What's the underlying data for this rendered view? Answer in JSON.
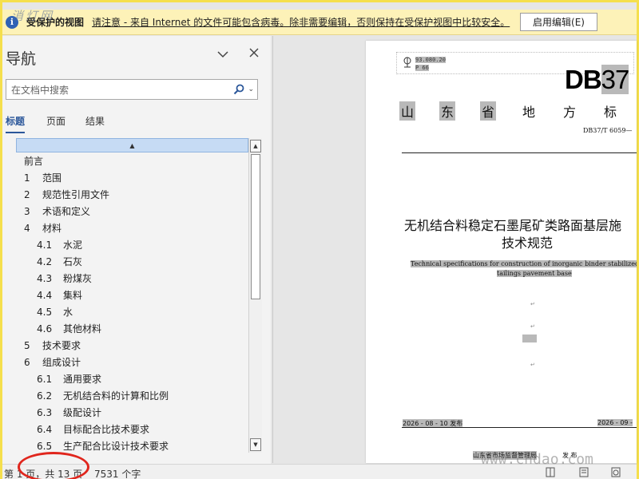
{
  "watermark": {
    "top_left": "消灯网",
    "bottom_right": "www.cndao.com"
  },
  "infobar": {
    "title": "受保护的视图",
    "message": "请注意 - 来自 Internet 的文件可能包含病毒。除非需要编辑，否则保持在受保护视图中比较安全。",
    "enable_button": "启用编辑(E)"
  },
  "nav": {
    "title": "导航",
    "search_placeholder": "在文档中搜索",
    "tabs": [
      {
        "label": "标题",
        "active": true
      },
      {
        "label": "页面",
        "active": false
      },
      {
        "label": "结果",
        "active": false
      }
    ],
    "items": [
      {
        "num": "",
        "text": "前言",
        "level": 0,
        "expand": false
      },
      {
        "num": "1",
        "text": "范围",
        "level": 0,
        "expand": false
      },
      {
        "num": "2",
        "text": "规范性引用文件",
        "level": 0,
        "expand": false
      },
      {
        "num": "3",
        "text": "术语和定义",
        "level": 0,
        "expand": false
      },
      {
        "num": "4",
        "text": "材料",
        "level": 0,
        "expand": true
      },
      {
        "num": "4.1",
        "text": "水泥",
        "level": 1,
        "expand": false
      },
      {
        "num": "4.2",
        "text": "石灰",
        "level": 1,
        "expand": false
      },
      {
        "num": "4.3",
        "text": "粉煤灰",
        "level": 1,
        "expand": false
      },
      {
        "num": "4.4",
        "text": "集料",
        "level": 1,
        "expand": false
      },
      {
        "num": "4.5",
        "text": "水",
        "level": 1,
        "expand": false
      },
      {
        "num": "4.6",
        "text": "其他材料",
        "level": 1,
        "expand": false
      },
      {
        "num": "5",
        "text": "技术要求",
        "level": 0,
        "expand": false
      },
      {
        "num": "6",
        "text": "组成设计",
        "level": 0,
        "expand": true
      },
      {
        "num": "6.1",
        "text": "通用要求",
        "level": 1,
        "expand": false
      },
      {
        "num": "6.2",
        "text": "无机结合料的计算和比例",
        "level": 1,
        "expand": false
      },
      {
        "num": "6.3",
        "text": "级配设计",
        "level": 1,
        "expand": false
      },
      {
        "num": "6.4",
        "text": "目标配合比技术要求",
        "level": 1,
        "expand": false
      },
      {
        "num": "6.5",
        "text": "生产配合比设计技术要求",
        "level": 1,
        "expand": false
      }
    ]
  },
  "document": {
    "code_line1": "93.080.20",
    "code_line2": "P 66",
    "db_prefix": "DB",
    "db_number": "37",
    "province_chars": [
      "山",
      "东",
      "省",
      "地",
      "方",
      "标"
    ],
    "standard_no": "DB37/T 6059—",
    "title_cn_line1": "无机结合料稳定石墨尾矿类路面基层施",
    "title_cn_line2": "技术规范",
    "title_en_line1": "Technical specifications for construction of inorganic binder stabilized grap",
    "title_en_line2": "tailings pavement base",
    "issue_date": "2026 - 08 - 10 发布",
    "impl_date": "2026 - 09 -",
    "issuer": "山东省市场监督管理局",
    "issuer_action": "发 布"
  },
  "status": {
    "page_info": "第 1 页，共 13 页",
    "word_count": "7531 个字"
  },
  "colors": {
    "accent": "#2b579a",
    "infobar_bg": "#fdf2b8",
    "highlight": "#b9b9b9",
    "annotation": "#e0261d"
  }
}
